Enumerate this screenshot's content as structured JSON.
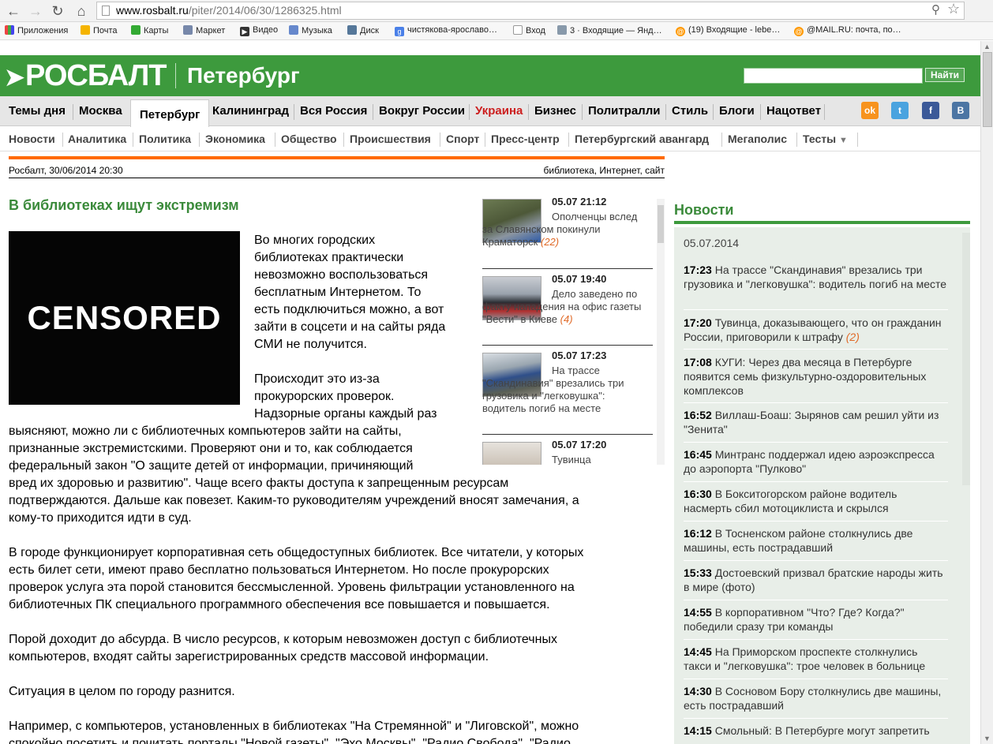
{
  "browser": {
    "url_domain": "www.rosbalt.ru",
    "url_path": "/piter/2014/06/30/1286325.html",
    "bookmarks": [
      "Приложения",
      "Почта",
      "Карты",
      "Маркет",
      "Видео",
      "Музыка",
      "Диск",
      "чистякова-ярославо…",
      "Вход",
      "3 · Входящие — Янд…",
      "(19) Входящие - lebe…",
      "@MAIL.RU: почта, по…"
    ]
  },
  "header": {
    "logo": "РОСБАЛТ",
    "city": "Петербург",
    "search_placeholder": "",
    "search_button": "Найти"
  },
  "topnav": [
    "Темы дня",
    "Москва",
    "Петербург",
    "Калининград",
    "Вся Россия",
    "Вокруг России",
    "Украина",
    "Бизнес",
    "Политралли",
    "Стиль",
    "Блоги",
    "Нацответ"
  ],
  "social": [
    "ok",
    "t",
    "f",
    "B"
  ],
  "subnav": [
    "Новости",
    "Аналитика",
    "Политика",
    "Экономика",
    "Общество",
    "Происшествия",
    "Спорт",
    "Пресс-центр",
    "Петербургский авангард",
    "Мегаполис",
    "Тесты"
  ],
  "article": {
    "source": "Росбалт, 30/06/2014 20:30",
    "tags": "библиотека, Интернет, сайт",
    "title": "В библиотеках ищут экстремизм",
    "image_text": "CENSORED",
    "p1a": [
      "Во многих городских",
      "библиотеках практически",
      "невозможно воспользоваться",
      "бесплатным Интернетом. То",
      "есть подключиться можно, а вот",
      "зайти в соцсети и на сайты ряда",
      "СМИ не получится."
    ],
    "p2a": [
      "Происходит это из-за",
      "прокурорских проверок.",
      "Надзорные органы каждый раз"
    ],
    "p2b": [
      "выясняют, можно ли с библиотечных компьютеров зайти на сайты,",
      "признанные экстремистскими. Проверяют они и то, как соблюдается",
      "федеральный закон \"О защите детей от информации, причиняющий"
    ],
    "p2c": [
      "вред их здоровью и развитию\". Чаще всего факты доступа к запрещенным ресурсам",
      "подтверждаются. Дальше как повезет. Каким-то руководителям учреждений вносят замечания, а",
      "кому-то приходится идти в суд."
    ],
    "p3": [
      "В городе функционирует корпоративная сеть общедоступных библиотек. Все читатели, у которых",
      "есть билет сети, имеют право бесплатно пользоваться Интернетом. Но после прокурорских",
      "проверок услуга эта порой становится бессмысленной. Уровень фильтрации установленного на",
      "библиотечных ПК специального программного обеспечения все повышается и повышается."
    ],
    "p4": [
      "Порой доходит до абсурда. В число ресурсов, к которым невозможен доступ с библиотечных",
      "компьютеров, входят сайты зарегистрированных средств массовой информации."
    ],
    "p5": [
      "Ситуация в целом по городу разнится."
    ],
    "p6": [
      "Например, с компьютеров, установленных в библиотеках \"На Стремянной\" и \"Лиговской\", можно",
      "спокойно посетить и почитать порталы \"Новой газеты\", \"Эхо Москвы\", \"Радио Свобода\", \"Радио"
    ]
  },
  "teasers": [
    {
      "time": "05.07 21:12",
      "text": "Ополченцы вслед за Славянском покинули Краматорск",
      "count": "(22)"
    },
    {
      "time": "05.07 19:40",
      "text": "Дело заведено по факту нападения на офис газеты \"Вести\" в Киеве",
      "count": "(4)"
    },
    {
      "time": "05.07 17:23",
      "text": "На трассе \"Скандинавия\" врезались три грузовика и \"легковушка\": водитель погиб на месте",
      "count": ""
    },
    {
      "time": "05.07 17:20",
      "text": "Тувинца",
      "count": ""
    }
  ],
  "news": {
    "title": "Новости",
    "date": "05.07.2014",
    "items": [
      {
        "time": "17:23",
        "text": "На трассе \"Скандинавия\" врезались три грузовика и \"легковушка\": водитель погиб на месте",
        "count": ""
      },
      {
        "time": "17:20",
        "text": "Тувинца, доказывающего, что он гражданин России, приговорили к штрафу",
        "count": "(2)"
      },
      {
        "time": "17:08",
        "text": "КУГИ: Через два месяца в Петербурге появится семь физкультурно-оздоровительных комплексов",
        "count": ""
      },
      {
        "time": "16:52",
        "text": "Виллаш-Боаш: Зырянов сам решил уйти из \"Зенита\"",
        "count": ""
      },
      {
        "time": "16:45",
        "text": "Минтранс поддержал идею аэроэкспресса до аэропорта \"Пулково\"",
        "count": ""
      },
      {
        "time": "16:30",
        "text": "В Бокситогорском районе водитель насмерть сбил мотоциклиста и скрылся",
        "count": ""
      },
      {
        "time": "16:12",
        "text": "В Тосненском районе столкнулись две машины, есть пострадавший",
        "count": ""
      },
      {
        "time": "15:33",
        "text": "Достоевский призвал братские народы жить в мире (фото)",
        "count": ""
      },
      {
        "time": "14:55",
        "text": "В корпоративном \"Что? Где? Когда?\" победили сразу три команды",
        "count": ""
      },
      {
        "time": "14:45",
        "text": "На Приморском проспекте столкнулись такси и \"легковушка\": трое человек в больнице",
        "count": ""
      },
      {
        "time": "14:30",
        "text": "В Сосновом Бору столкнулись две машины, есть пострадавший",
        "count": ""
      },
      {
        "time": "14:15",
        "text": "Смольный: В Петербурге могут запретить",
        "count": ""
      }
    ]
  }
}
